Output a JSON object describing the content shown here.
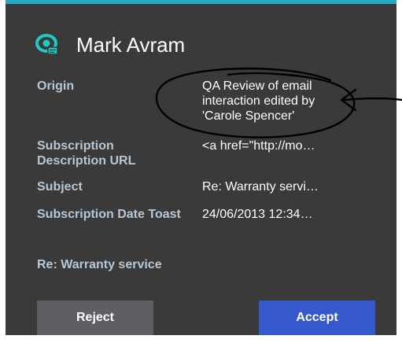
{
  "toast": {
    "title": "Mark Avram",
    "fields": [
      {
        "label": "Origin",
        "value": "QA Review of email interaction edited by 'Carole Spencer'"
      },
      {
        "label": "Subscription Description URL",
        "value": "<a href=\"http://mo…"
      },
      {
        "label": "Subject",
        "value": "Re: Warranty servi…"
      },
      {
        "label": "Subscription Date Toast",
        "value": "24/06/2013 12:34…"
      }
    ],
    "footer_subject": "Re: Warranty service",
    "reject_label": "Reject",
    "accept_label": "Accept"
  },
  "colors": {
    "panel_bg": "#3a3a3a",
    "top_border": "#2aa9c5",
    "accent_teal": "#1fc9c4",
    "label_color": "#b7c7d4",
    "reject_bg": "#5d5f63",
    "accept_bg": "#3558cc"
  },
  "icons": {
    "app_logo": "eye-with-card-icon"
  }
}
